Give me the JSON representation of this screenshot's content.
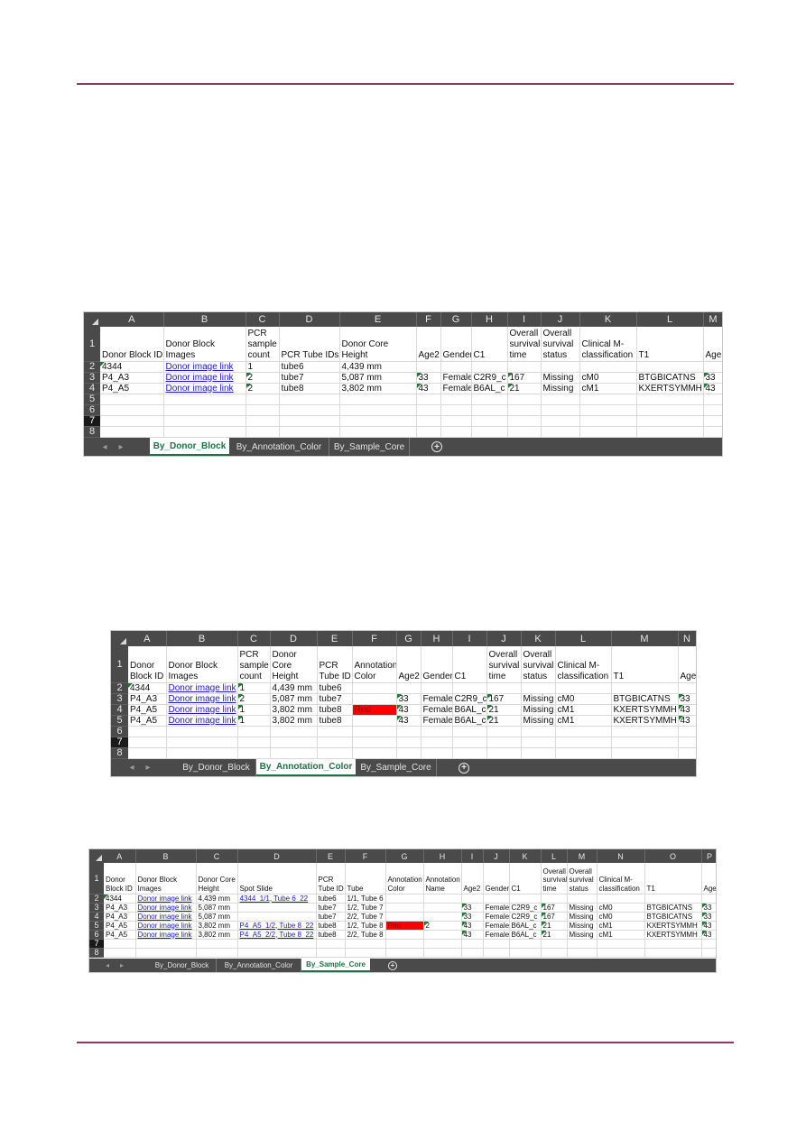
{
  "document": {
    "accent_color": "#8b3a62"
  },
  "sheet_tabs": [
    "By_Donor_Block",
    "By_Annotation_Color",
    "By_Sample_Core"
  ],
  "sheets": [
    {
      "active_tab": 0,
      "columns": [
        "A",
        "B",
        "C",
        "D",
        "E",
        "F",
        "G",
        "H",
        "I",
        "J",
        "K",
        "L",
        "M"
      ],
      "headers": [
        "Donor Block ID",
        "Donor Block Images",
        "PCR sample count",
        "PCR Tube IDs",
        "Donor Core Height",
        "Age2",
        "Gender",
        "C1",
        "Overall survival time",
        "Overall survival status",
        "Clinical M-classification",
        "T1",
        "Age"
      ],
      "rows": [
        [
          "4344",
          "Donor image link",
          "1",
          "tube6",
          "4,439 mm",
          "",
          "",
          "",
          "",
          "",
          "",
          "",
          ""
        ],
        [
          "P4_A3",
          "Donor image link",
          "2",
          "tube7",
          "5,087 mm",
          "33",
          "Female",
          "C2R9_c",
          "167",
          "Missing",
          "cM0",
          "BTGBICATNS",
          "33"
        ],
        [
          "P4_A5",
          "Donor image link",
          "2",
          "tube8",
          "3,802 mm",
          "43",
          "Female",
          "B6AL_c",
          "21",
          "Missing",
          "cM1",
          "KXERTSYMMH",
          "43"
        ]
      ],
      "row_numbers": [
        "1",
        "2",
        "3",
        "4",
        "5",
        "6",
        "7",
        "8"
      ],
      "active_row": "7"
    },
    {
      "active_tab": 1,
      "columns": [
        "A",
        "B",
        "C",
        "D",
        "E",
        "F",
        "G",
        "H",
        "I",
        "J",
        "K",
        "L",
        "M",
        "N"
      ],
      "headers": [
        "Donor Block ID",
        "Donor Block Images",
        "PCR sample count",
        "Donor Core Height",
        "PCR Tube ID",
        "Annotation Color",
        "Age2",
        "Gender",
        "C1",
        "Overall survival time",
        "Overall survival status",
        "Clinical M-classification",
        "T1",
        "Age"
      ],
      "rows": [
        [
          "4344",
          "Donor image link",
          "1",
          "4,439 mm",
          "tube6",
          "",
          "",
          "",
          "",
          "",
          "",
          "",
          "",
          ""
        ],
        [
          "P4_A3",
          "Donor image link",
          "2",
          "5,087 mm",
          "tube7",
          "",
          "33",
          "Female",
          "C2R9_c",
          "167",
          "Missing",
          "cM0",
          "BTGBICATNS",
          "33"
        ],
        [
          "P4_A5",
          "Donor image link",
          "1",
          "3,802 mm",
          "tube8",
          "Red",
          "43",
          "Female",
          "B6AL_c",
          "21",
          "Missing",
          "cM1",
          "KXERTSYMMH",
          "43"
        ],
        [
          "P4_A5",
          "Donor image link",
          "1",
          "3,802 mm",
          "tube8",
          "",
          "43",
          "Female",
          "B6AL_c",
          "21",
          "Missing",
          "cM1",
          "KXERTSYMMH",
          "43"
        ]
      ],
      "row_numbers": [
        "1",
        "2",
        "3",
        "4",
        "5",
        "6",
        "7",
        "8"
      ],
      "active_row": "7",
      "annotation_color_hex": "#ff0000"
    },
    {
      "active_tab": 2,
      "columns": [
        "A",
        "B",
        "C",
        "D",
        "E",
        "F",
        "G",
        "H",
        "I",
        "J",
        "K",
        "L",
        "M",
        "N",
        "O",
        "P"
      ],
      "headers": [
        "Donor Block ID",
        "Donor Block Images",
        "Donor Core Height",
        "Spot Slide",
        "PCR Tube ID",
        "Tube",
        "Annotation Color",
        "Annotation Name",
        "Age2",
        "Gender",
        "C1",
        "Overall survival time",
        "Overall survival status",
        "Clinical M-classification",
        "T1",
        "Age"
      ],
      "rows": [
        [
          "4344",
          "Donor image link",
          "4,439 mm",
          "4344_1/1, Tube 6_22",
          "tube6",
          "1/1, Tube 6",
          "",
          "",
          "",
          "",
          "",
          "",
          "",
          "",
          "",
          ""
        ],
        [
          "P4_A3",
          "Donor image link",
          "5,087 mm",
          "",
          "tube7",
          "1/2, Tube 7",
          "",
          "",
          "33",
          "Female",
          "C2R9_c",
          "167",
          "Missing",
          "cM0",
          "BTGBICATNS",
          "33"
        ],
        [
          "P4_A3",
          "Donor image link",
          "5,087 mm",
          "",
          "tube7",
          "2/2, Tube 7",
          "",
          "",
          "33",
          "Female",
          "C2R9_c",
          "167",
          "Missing",
          "cM0",
          "BTGBICATNS",
          "33"
        ],
        [
          "P4_A5",
          "Donor image link",
          "3,802 mm",
          "P4_A5_1/2, Tube 8_22",
          "tube8",
          "1/2, Tube 8",
          "Red",
          "2",
          "43",
          "Female",
          "B6AL_c",
          "21",
          "Missing",
          "cM1",
          "KXERTSYMMH",
          "43"
        ],
        [
          "P4_A5",
          "Donor image link",
          "3,802 mm",
          "P4_A5_2/2, Tube 8_22",
          "tube8",
          "2/2, Tube 8",
          "",
          "",
          "43",
          "Female",
          "B6AL_c",
          "21",
          "Missing",
          "cM1",
          "KXERTSYMMH",
          "43"
        ]
      ],
      "row_numbers": [
        "1",
        "2",
        "3",
        "4",
        "5",
        "6",
        "7",
        "8"
      ],
      "active_row": "7",
      "annotation_color_hex": "#ff0000"
    }
  ],
  "icons": {
    "tab_prev": "◂",
    "tab_next": "▸",
    "add_sheet": "+"
  }
}
